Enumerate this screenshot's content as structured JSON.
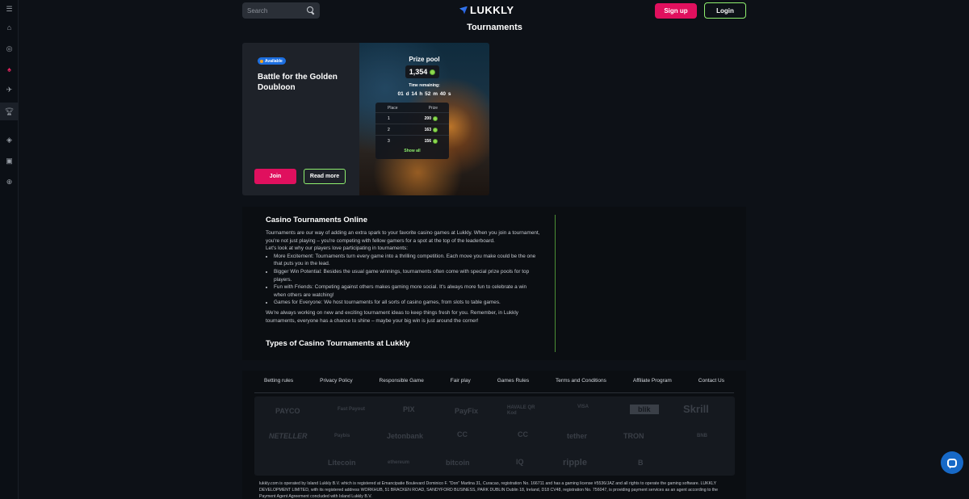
{
  "header": {
    "search_placeholder": "Search",
    "logo_text": "LUKKLY",
    "signup_label": "Sign up",
    "login_label": "Login"
  },
  "page_title": "Tournaments",
  "tournament": {
    "badge": "Available",
    "title": "Battle for the Golden Doubloon",
    "join_label": "Join",
    "read_more_label": "Read more",
    "prize_pool_label": "Prize pool",
    "prize_pool_value": "1,354",
    "time_remaining_label": "Time remaining:",
    "timer": "01 d 14 h 52 m 40 s",
    "table": {
      "headers": [
        "Place",
        "Prize"
      ],
      "rows": [
        {
          "place": "1",
          "prize": "200"
        },
        {
          "place": "2",
          "prize": "163"
        },
        {
          "place": "3",
          "prize": "156"
        }
      ],
      "show_all": "Show all"
    }
  },
  "info": {
    "heading": "Casino Tournaments Online",
    "intro": "Tournaments are our way of adding an extra spark to your favorite casino games at Lukkly. When you join a tournament, you're not just playing – you're competing with fellow gamers for a spot at the top of the leaderboard.",
    "lead": "Let's look at why our players love participating in tournaments:",
    "bullets": [
      "More Excitement: Tournaments turn every game into a thrilling competition. Each move you make could be the one that puts you in the lead.",
      "Bigger Win Potential: Besides the usual game winnings, tournaments often come with special prize pools for top players.",
      "Fun with Friends: Competing against others makes gaming more social. It's always more fun to celebrate a win when others are watching!",
      "Games for Everyone: We host tournaments for all sorts of casino games, from slots to table games."
    ],
    "outro": "We're always working on new and exciting tournament ideas to keep things fresh for you. Remember, in Lukkly tournaments, everyone has a chance to shine – maybe your big win is just around the corner!",
    "subheading": "Types of Casino Tournaments at Lukkly"
  },
  "footer": {
    "links": [
      "Betting rules",
      "Privacy Policy",
      "Responsible Game",
      "Fair play",
      "Games Rules",
      "Terms and Conditions",
      "Affiliate Program",
      "Contact Us"
    ],
    "payments": [
      "PAYCO",
      "Fast Payout",
      "PIX",
      "PayFix",
      "HAVALE QR Kod",
      "VISA",
      "blik",
      "Skrill",
      "NETELLER",
      "Paybis",
      "Jetonbank",
      "CC",
      "CC",
      "tether",
      "TRON",
      "BNB",
      "Litecoin",
      "ethereum",
      "bitcoin",
      "IQ",
      "ripple",
      "B"
    ],
    "legal": "lukkly.com is operated by Island Lukkly B.V. which is registered at Emancipatie Boulevard Dominico F. \"Don\" Martina 31, Curacao, registration No. 166711 and has a gaming license #5536/JAZ and all rights to operate the gaming software. LUKKLY DEVELOPMENT LIMITED, with its registered address WORKHUB, 51 BRACKEN ROAD, SANDYFORD BUSINESS, PARK DUBLIN Dublin 18, Ireland, D18 CV48, registration No. 756047, is providing payment services as an agent according to the Payment Agent Agreement concluded with Island Lukkly B.V."
  },
  "colors": {
    "accent_pink": "#e0105e",
    "accent_green": "#8ff06f",
    "background": "#0d1117"
  }
}
